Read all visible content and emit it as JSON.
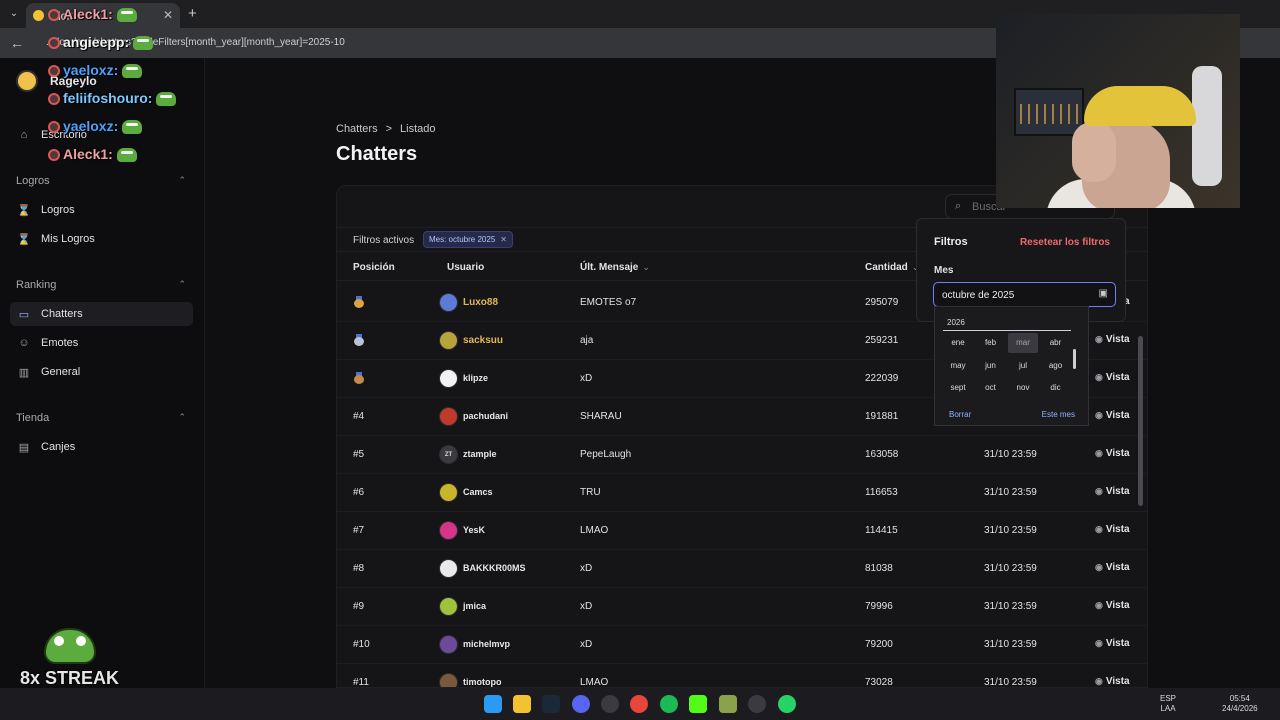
{
  "browser": {
    "tab_title": "Kick",
    "url": "....lo.../app/chatters?tableFilters[month_year][month_year]=2025-10"
  },
  "sidebar": {
    "brand": "Rageylo",
    "home": "Escritorio",
    "groups": [
      {
        "label": "Logros",
        "items": [
          "Logros",
          "Mis Logros"
        ]
      },
      {
        "label": "Ranking",
        "items": [
          "Chatters",
          "Emotes",
          "General"
        ]
      },
      {
        "label": "Tienda",
        "items": [
          "Canjes"
        ]
      }
    ]
  },
  "breadcrumb": {
    "first": "Chatters",
    "sep": ">",
    "second": "Listado"
  },
  "page_title": "Chatters",
  "search": {
    "placeholder": "Buscar"
  },
  "filter_bar": {
    "label": "Filtros activos",
    "chip": "Mes: octubre 2025"
  },
  "table": {
    "headers": {
      "pos": "Posición",
      "user": "Usuario",
      "msg": "Últ. Mensaje",
      "qty": "Cantidad"
    },
    "view_label": "Vista",
    "rows": [
      {
        "pos": "",
        "medal": "gold",
        "user": "Luxo88",
        "msg": "EMOTES o7",
        "qty": "295079",
        "date": "",
        "avatar": "#5b7bd6",
        "initials": ""
      },
      {
        "pos": "",
        "medal": "silver",
        "user": "sacksuu",
        "msg": "aja",
        "qty": "259231",
        "date": "",
        "avatar": "#b8a23a",
        "initials": ""
      },
      {
        "pos": "",
        "medal": "bronze",
        "user": "klipze",
        "msg": "xD",
        "qty": "222039",
        "date": "",
        "avatar": "#f2f2f2",
        "initials": ""
      },
      {
        "pos": "#4",
        "medal": "",
        "user": "pachudani",
        "msg": "SHARAU",
        "qty": "191881",
        "date": "",
        "avatar": "#c0392b",
        "initials": ""
      },
      {
        "pos": "#5",
        "medal": "",
        "user": "ztample",
        "msg": "PepeLaugh",
        "qty": "163058",
        "date": "31/10 23:59",
        "avatar": "#3a3a3f",
        "initials": "ZT"
      },
      {
        "pos": "#6",
        "medal": "",
        "user": "Camcs",
        "msg": "TRU",
        "qty": "116653",
        "date": "31/10 23:59",
        "avatar": "#c8b52a",
        "initials": ""
      },
      {
        "pos": "#7",
        "medal": "",
        "user": "YesK",
        "msg": "LMAO",
        "qty": "114415",
        "date": "31/10 23:59",
        "avatar": "#d6338a",
        "initials": ""
      },
      {
        "pos": "#8",
        "medal": "",
        "user": "BAKKKR00MS",
        "msg": "xD",
        "qty": "81038",
        "date": "31/10 23:59",
        "avatar": "#eaeaea",
        "initials": ""
      },
      {
        "pos": "#9",
        "medal": "",
        "user": "jmica",
        "msg": "xD",
        "qty": "79996",
        "date": "31/10 23:59",
        "avatar": "#9fc23a",
        "initials": ""
      },
      {
        "pos": "#10",
        "medal": "",
        "user": "michelmvp",
        "msg": "xD",
        "qty": "79200",
        "date": "31/10 23:59",
        "avatar": "#6b4a9a",
        "initials": ""
      },
      {
        "pos": "#11",
        "medal": "",
        "user": "timotopo",
        "msg": "LMAO",
        "qty": "73028",
        "date": "31/10 23:59",
        "avatar": "#7a5a3a",
        "initials": ""
      }
    ]
  },
  "filters_popover": {
    "title": "Filtros",
    "reset": "Resetear los filtros",
    "field_label": "Mes",
    "field_value": "octubre de 2025"
  },
  "month_picker": {
    "year": "2026",
    "months": [
      "ene",
      "feb",
      "mar",
      "abr",
      "may",
      "jun",
      "jul",
      "ago",
      "sept",
      "oct",
      "nov",
      "dic"
    ],
    "highlighted": "mar",
    "clear": "Borrar",
    "this_month": "Este mes"
  },
  "overlay": {
    "chat": [
      {
        "name": "Aleck1:",
        "color": "#f0a0a0"
      },
      {
        "name": "angieepp:",
        "color": "#f2f2f2"
      },
      {
        "name": "yaeloxz:",
        "color": "#4aa3ff"
      },
      {
        "name": "feliifoshouro:",
        "color": "#7ec8ff"
      },
      {
        "name": "yaeloxz:",
        "color": "#4aa3ff"
      },
      {
        "name": "Aleck1:",
        "color": "#f0a0a0"
      }
    ],
    "streak": "8x STREAK"
  },
  "taskbar": {
    "lang": "ESP",
    "lang2": "LAA",
    "time": "05:54",
    "date": "24/4/2026"
  },
  "colors": {
    "accent": "#6f7fff",
    "gold": "#e0b857",
    "danger": "#ef6b6b"
  }
}
